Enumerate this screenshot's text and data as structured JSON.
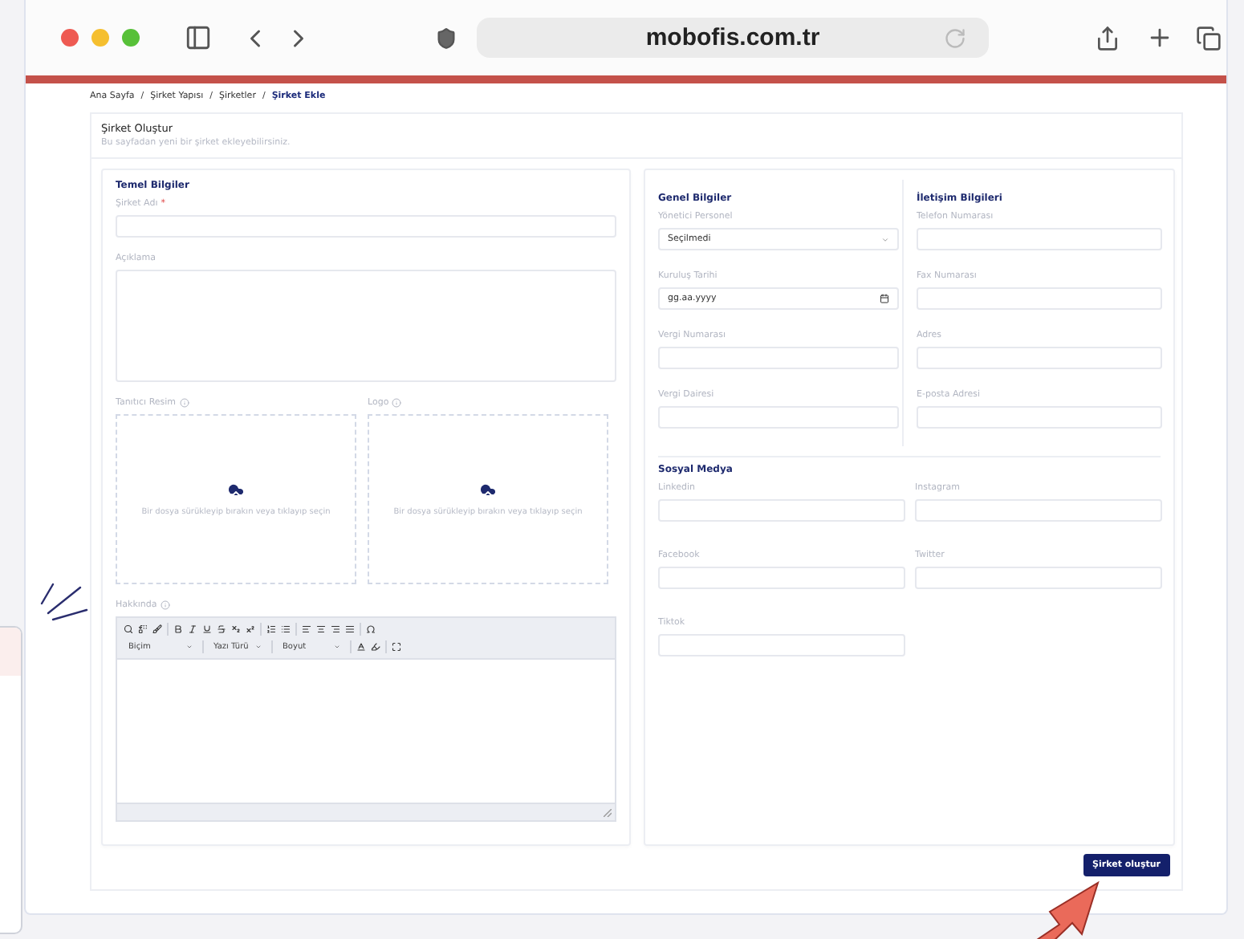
{
  "browser": {
    "url": "mobofis.com.tr"
  },
  "breadcrumb": [
    {
      "label": "Ana Sayfa",
      "selected": false
    },
    {
      "label": "Şirket Yapısı",
      "selected": false
    },
    {
      "label": "Şirketler",
      "selected": false
    },
    {
      "label": "Şirket Ekle",
      "selected": true
    }
  ],
  "breadcrumb_separator": "/",
  "page_header": {
    "title": "Şirket Oluştur",
    "subtitle": "Bu sayfadan yeni bir şirket ekleyebilirsiniz."
  },
  "basic_info": {
    "title": "Temel Bilgiler",
    "fields": [
      {
        "label": "Şirket Adı",
        "required_mark": "*",
        "kind": "input"
      },
      {
        "label": "Açıklama",
        "kind": "textarea"
      }
    ],
    "uploads": [
      {
        "label": "Tanıtıcı Resim",
        "hint": "Bir dosya sürükleyip bırakın veya tıklayıp seçin"
      },
      {
        "label": "Logo",
        "hint": "Bir dosya sürükleyip bırakın veya tıklayıp seçin"
      }
    ],
    "editor": {
      "label": "Hakkında",
      "dropdowns": [
        "Biçim",
        "Yazı Türü",
        "Boyut"
      ]
    }
  },
  "general_info": {
    "title": "Genel Bilgiler",
    "fields": [
      {
        "label": "Yönetici Personel",
        "kind": "select",
        "value": "Seçilmedi"
      },
      {
        "label": "Kuruluş Tarihi",
        "kind": "date",
        "value": "gg.aa.yyyy"
      },
      {
        "label": "Vergi Numarası",
        "kind": "input"
      },
      {
        "label": "Vergi Dairesi",
        "kind": "input"
      }
    ]
  },
  "contact_info": {
    "title": "İletişim Bilgileri",
    "fields": [
      {
        "label": "Telefon Numarası",
        "kind": "input"
      },
      {
        "label": "Fax Numarası",
        "kind": "input"
      },
      {
        "label": "Adres",
        "kind": "input"
      },
      {
        "label": "E-posta Adresi",
        "kind": "input"
      }
    ]
  },
  "social_media": {
    "title": "Sosyal Medya",
    "fields": [
      {
        "label": "Linkedin",
        "kind": "input"
      },
      {
        "label": "Instagram",
        "kind": "input"
      },
      {
        "label": "Facebook",
        "kind": "input"
      },
      {
        "label": "Twitter",
        "kind": "input"
      },
      {
        "label": "Tiktok",
        "kind": "input"
      }
    ]
  },
  "submit_button": "Şirket oluştur"
}
